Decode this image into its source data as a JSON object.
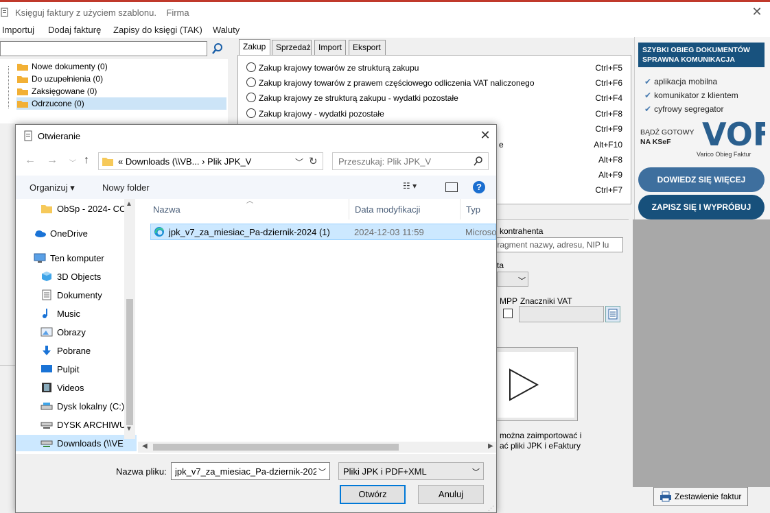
{
  "app": {
    "title": "Księguj faktury z użyciem szablonu.",
    "firma": "Firma",
    "close": "✕"
  },
  "menu": [
    "Importuj",
    "Dodaj fakturę",
    "Zapisy do księgi (TAK)",
    "Waluty"
  ],
  "tree": [
    {
      "label": "Nowe dokumenty (0)"
    },
    {
      "label": "Do uzupełnienia (0)"
    },
    {
      "label": "Zaksięgowane (0)"
    },
    {
      "label": "Odrzucone (0)"
    }
  ],
  "tabs": [
    "Zakup",
    "Sprzedaż",
    "Import",
    "Eksport"
  ],
  "options": [
    {
      "label": "Zakup krajowy towarów ze strukturą zakupu",
      "shortcut": "Ctrl+F5"
    },
    {
      "label": "Zakup krajowy towarów z prawem częściowego odliczenia VAT naliczonego",
      "shortcut": "Ctrl+F6"
    },
    {
      "label": "Zakup krajowy ze strukturą zakupu - wydatki pozostałe",
      "shortcut": "Ctrl+F4"
    },
    {
      "label": "Zakup krajowy - wydatki pozostałe",
      "shortcut": "Ctrl+F8"
    },
    {
      "label": "",
      "shortcut": "Ctrl+F9"
    },
    {
      "label": "e",
      "shortcut": "Alt+F10"
    },
    {
      "label": "",
      "shortcut": "Alt+F8"
    },
    {
      "label": "",
      "shortcut": "Alt+F9"
    },
    {
      "label": "",
      "shortcut": "Ctrl+F7"
    }
  ],
  "promo": {
    "head1": "SZYBKI OBIEG DOKUMENTÓW",
    "head2": "SPRAWNA KOMUNIKACJA",
    "items": [
      "aplikacja mobilna",
      "komunikator z klientem",
      "cyfrowy segregator"
    ],
    "ready1": "BĄDŹ GOTOWY",
    "ready2": "NA KSeF",
    "logo_text": "VOF",
    "logo_sub": "Varico Obieg Faktur",
    "btn1": "DOWIEDZ SIĘ WIĘCEJ",
    "btn2": "ZAPISZ SIĘ I WYPRÓBUJ",
    "btn1_color": "#3e6f9e",
    "btn2_color": "#17507b"
  },
  "right_form": {
    "kontrahent": "kontrahenta",
    "fragment": "fragment nazwy, adresu, NIP lu",
    "ta": "ta",
    "mpp": "MPP",
    "znaczniki": "Znaczniki VAT",
    "import_line1": "można zaimportować i",
    "import_line2": "ać pliki JPK i eFaktury"
  },
  "zestawienie": "Zestawienie faktur",
  "dialog": {
    "title": "Otwieranie",
    "path": "«  Downloads (\\\\VB...  ›  Plik JPK_V",
    "search_placeholder": "Przeszukaj: Plik JPK_V",
    "organize": "Organizuj ▾",
    "new_folder": "Nowy folder",
    "nav": [
      {
        "label": "ObSp - 2024- CC",
        "indent": 1,
        "icon": "folder-icon"
      },
      {
        "label": "OneDrive",
        "indent": 0,
        "icon": "onedrive-icon"
      },
      {
        "label": "Ten komputer",
        "indent": 0,
        "icon": "computer-icon"
      },
      {
        "label": "3D Objects",
        "indent": 1,
        "icon": "cube-icon"
      },
      {
        "label": "Dokumenty",
        "indent": 1,
        "icon": "document-icon"
      },
      {
        "label": "Music",
        "indent": 1,
        "icon": "music-icon"
      },
      {
        "label": "Obrazy",
        "indent": 1,
        "icon": "picture-icon"
      },
      {
        "label": "Pobrane",
        "indent": 1,
        "icon": "download-icon"
      },
      {
        "label": "Pulpit",
        "indent": 1,
        "icon": "desktop-icon"
      },
      {
        "label": "Videos",
        "indent": 1,
        "icon": "video-icon"
      },
      {
        "label": "Dysk lokalny (C:)",
        "indent": 1,
        "icon": "drive-icon"
      },
      {
        "label": "DYSK ARCHIWU",
        "indent": 1,
        "icon": "network-drive-icon"
      },
      {
        "label": "Downloads (\\\\VE",
        "indent": 1,
        "icon": "network-drive-icon"
      }
    ],
    "columns": [
      "Nazwa",
      "Data modyfikacji",
      "Typ"
    ],
    "file": {
      "name": "jpk_v7_za_miesiac_Pa-dziernik-2024 (1)",
      "date": "2024-12-03 11:59",
      "type": "Microso"
    },
    "filename_label": "Nazwa pliku:",
    "filename_value": "jpk_v7_za_miesiac_Pa-dziernik-202",
    "filetype": "Pliki JPK i PDF+XML",
    "open": "Otwórz",
    "cancel": "Anuluj"
  }
}
